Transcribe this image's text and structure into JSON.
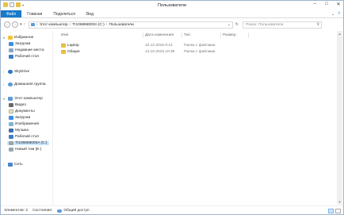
{
  "window": {
    "title": "Пользователи",
    "controls": [
      "–",
      "□",
      "✕"
    ]
  },
  "ribbon": {
    "tabs": [
      "Файл",
      "Главная",
      "Поделиться",
      "Вид"
    ]
  },
  "address": {
    "crumbs": [
      "Этот компьютер",
      "TI106868000A (C:)",
      "Пользователи"
    ],
    "search_placeholder": "Поиск: Пользователи"
  },
  "navpane": {
    "favorites": {
      "label": "Избранное",
      "items": [
        "Загрузки",
        "Недавние места",
        "Рабочий стол"
      ]
    },
    "skydrive": "SkyDrive",
    "homegroup": "Домашняя группа",
    "computer": {
      "label": "Этот компьютер",
      "items": [
        "Видео",
        "Документы",
        "Загрузки",
        "Изображения",
        "Музыка",
        "Рабочий стол",
        "TI106868000A (C:)",
        "Новый том (E:)"
      ]
    },
    "network": "Сеть"
  },
  "content": {
    "columns": [
      "Имя",
      "Дата изменения",
      "Тип",
      "Размер"
    ],
    "rows": [
      {
        "name": "Laptop",
        "date": "10.12.2015 0:14",
        "type": "Папка с файлами"
      },
      {
        "name": "Общие",
        "date": "14.10.2015 10:39",
        "type": "Папка с файлами"
      }
    ]
  },
  "status": {
    "count": "Элементов: 2",
    "state_label": "Состояние:",
    "state_value": "Общий доступ"
  }
}
